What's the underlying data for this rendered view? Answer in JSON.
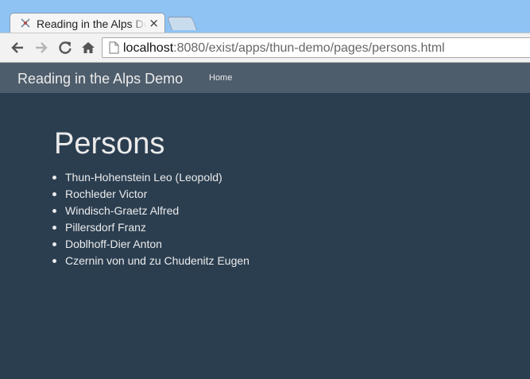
{
  "browser": {
    "tab_title": "Reading in the Alps Demo",
    "tab_close": "×",
    "url_host": "localhost",
    "url_rest": ":8080/exist/apps/thun-demo/pages/persons.html"
  },
  "navbar": {
    "brand": "Reading in the Alps Demo",
    "home_link": "Home"
  },
  "main": {
    "title": "Persons",
    "persons": [
      "Thun-Hohenstein Leo (Leopold)",
      "Rochleder Victor",
      "Windisch-Graetz Alfred",
      "Pillersdorf Franz",
      "Doblhoff-Dier Anton",
      "Czernin von und zu Chudenitz Eugen"
    ]
  },
  "colors": {
    "page_background": "#2b3e50",
    "navbar_background": "#4e5d6c",
    "text": "#ebebeb",
    "titlebar": "#8ec3f4"
  }
}
